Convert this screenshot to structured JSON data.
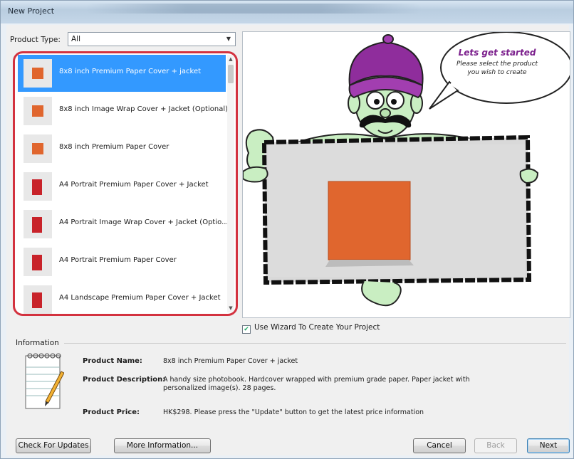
{
  "window": {
    "title": "New Project"
  },
  "filter": {
    "label": "Product Type:",
    "selected": "All"
  },
  "products": [
    {
      "label": "8x8 inch Premium Paper Cover + jacket",
      "selected": true,
      "color": "#e0662e"
    },
    {
      "label": "8x8 inch Image Wrap Cover + Jacket (Optional)",
      "selected": false,
      "color": "#e0662e"
    },
    {
      "label": "8x8 inch Premium Paper Cover",
      "selected": false,
      "color": "#e0662e"
    },
    {
      "label": "A4 Portrait Premium Paper Cover + Jacket",
      "selected": false,
      "color": "#c8232a"
    },
    {
      "label": "A4 Portrait Image Wrap Cover + Jacket (Optio...",
      "selected": false,
      "color": "#c8232a"
    },
    {
      "label": "A4 Portrait Premium Paper Cover",
      "selected": false,
      "color": "#c8232a"
    },
    {
      "label": "A4 Landscape Premium Paper Cover + Jacket",
      "selected": false,
      "color": "#c8232a"
    }
  ],
  "speech": {
    "heading": "Lets get started",
    "line1": "Please select the product",
    "line2": "you wish to create"
  },
  "wizard": {
    "label": "Use Wizard To Create Your Project",
    "checked": true
  },
  "info": {
    "title": "Information",
    "name_label": "Product Name:",
    "name_value": "8x8 inch Premium Paper Cover + jacket",
    "desc_label": "Product Description:",
    "desc_value": "A handy size photobook. Hardcover wrapped with premium grade paper. Paper jacket with personalized image(s). 28 pages.",
    "price_label": "Product Price:",
    "price_value": "HK$298. Please press the \"Update\" button to get the latest price information"
  },
  "buttons": {
    "check_updates": "Check For Updates",
    "more_info": "More Information...",
    "cancel": "Cancel",
    "back": "Back",
    "next": "Next"
  },
  "colors": {
    "selection": "#3399ff",
    "highlight_border": "#d3323f",
    "book": "#e0662e"
  }
}
